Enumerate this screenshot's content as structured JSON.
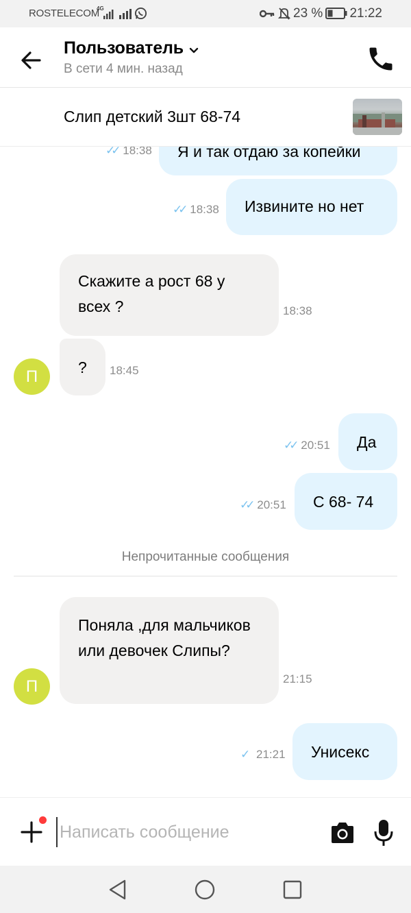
{
  "status_bar": {
    "carrier": "ROSTELECOM",
    "network": "4G",
    "battery_percent": "23 %",
    "time": "21:22"
  },
  "header": {
    "title": "Пользователь",
    "subtitle": "В сети 4 мин. назад"
  },
  "listing": {
    "title": "Слип детский 3шт 68-74"
  },
  "messages": [
    {
      "direction": "out",
      "text": "Я и так отдаю за копейки",
      "time": "18:38",
      "status": "read"
    },
    {
      "direction": "out",
      "text": "Извините но нет",
      "time": "18:38",
      "status": "read"
    },
    {
      "direction": "in",
      "text": "Скажите а рост 68 у всех ?",
      "time": "18:38"
    },
    {
      "direction": "in",
      "text": "?",
      "time": "18:45",
      "avatar": "П"
    },
    {
      "direction": "out",
      "text": "Да",
      "time": "20:51",
      "status": "read"
    },
    {
      "direction": "out",
      "text": "С 68- 74",
      "time": "20:51",
      "status": "read"
    },
    {
      "direction": "in",
      "text": "Поняла ,для мальчиков или девочек Слипы?",
      "time": "21:15",
      "avatar": "П"
    },
    {
      "direction": "out",
      "text": "Унисекс",
      "time": "21:21",
      "status": "sent"
    }
  ],
  "unread_divider": "Непрочитанные сообщения",
  "composer": {
    "placeholder": "Написать сообщение"
  },
  "colors": {
    "outgoing_bubble": "#e3f4fe",
    "incoming_bubble": "#f2f1f0",
    "avatar": "#d2df42",
    "check": "#7cc3ef",
    "badge": "#ff3b3b"
  },
  "icons": [
    "back-arrow-icon",
    "chevron-down-icon",
    "phone-icon",
    "plus-icon",
    "camera-icon",
    "microphone-icon",
    "double-check-icon",
    "single-check-icon"
  ]
}
